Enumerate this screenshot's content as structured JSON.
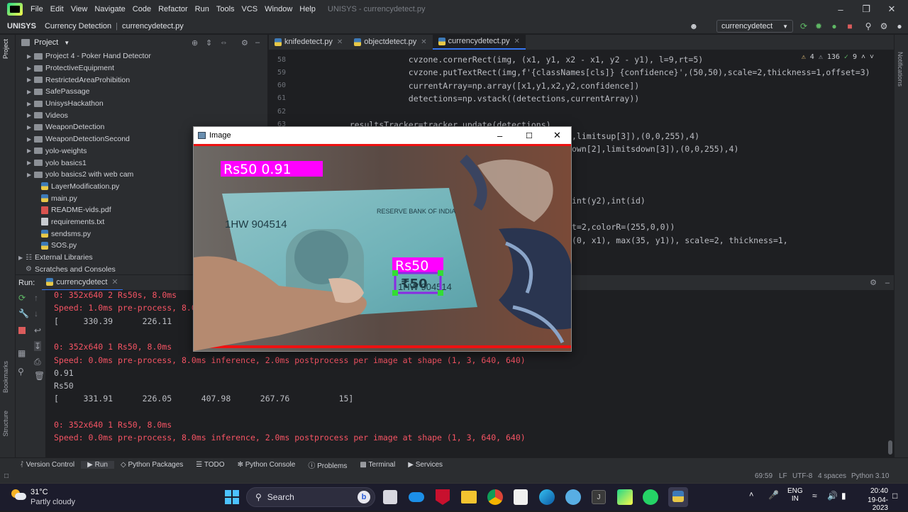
{
  "menubar": {
    "items": [
      "File",
      "Edit",
      "View",
      "Navigate",
      "Code",
      "Refactor",
      "Run",
      "Tools",
      "VCS",
      "Window",
      "Help"
    ],
    "title": "UNISYS - currencydetect.py"
  },
  "navbar": {
    "project": "UNISYS",
    "folder": "Currency Detection",
    "file": "currencydetect.py",
    "run_config": "currencydetect"
  },
  "project_panel": {
    "title": "Project",
    "items": [
      {
        "label": "Project 4 - Poker Hand Detector",
        "type": "folder"
      },
      {
        "label": "ProtectiveEquipment",
        "type": "folder"
      },
      {
        "label": "RestrictedAreaProhibition",
        "type": "folder"
      },
      {
        "label": "SafePassage",
        "type": "folder"
      },
      {
        "label": "UnisysHackathon",
        "type": "folder"
      },
      {
        "label": "Videos",
        "type": "folder"
      },
      {
        "label": "WeaponDetection",
        "type": "folder"
      },
      {
        "label": "WeaponDetectionSecond",
        "type": "folder"
      },
      {
        "label": "yolo-weights",
        "type": "folder"
      },
      {
        "label": "yolo basics1",
        "type": "folder"
      },
      {
        "label": "yolo basics2 with web cam",
        "type": "folder"
      },
      {
        "label": "LayerModification.py",
        "type": "py"
      },
      {
        "label": "main.py",
        "type": "py"
      },
      {
        "label": "README-vids.pdf",
        "type": "pdf"
      },
      {
        "label": "requirements.txt",
        "type": "txt"
      },
      {
        "label": "sendsms.py",
        "type": "py"
      },
      {
        "label": "SOS.py",
        "type": "py"
      },
      {
        "label": "External Libraries",
        "type": "lib"
      },
      {
        "label": "Scratches and Consoles",
        "type": "scratch"
      }
    ]
  },
  "tabs": [
    {
      "label": "knifedetect.py",
      "active": false
    },
    {
      "label": "objectdetect.py",
      "active": false
    },
    {
      "label": "currencydetect.py",
      "active": true
    }
  ],
  "inspection": {
    "warnings": "4",
    "weak": "136",
    "ok": "9"
  },
  "editor_lines": [
    {
      "num": "58",
      "code": "                cvzone.cornerRect(img, (x1, y1, x2 - x1, y2 - y1), l=9,rt=5)"
    },
    {
      "num": "59",
      "code": "                cvzone.putTextRect(img,f'{classNames[cls]} {confidence}',(50,50),scale=2,thickness=1,offset=3)"
    },
    {
      "num": "60",
      "code": "                currentArray=np.array([x1,y1,x2,y2,confidence])"
    },
    {
      "num": "61",
      "code": "                detections=np.vstack((detections,currentArray))"
    },
    {
      "num": "62",
      "code": ""
    },
    {
      "num": "63",
      "code": "    resultsTracker=tracker.update(detections)"
    }
  ],
  "editor_partial_lines": [
    {
      "code": ",limitsup[3]),(0,0,255),4)"
    },
    {
      "code": "own[2],limitsdown[3]),(0,0,255),4)"
    },
    {
      "code": "int(y2),int(id)"
    },
    {
      "code": "t=2,colorR=(255,0,0))"
    },
    {
      "code": "(0, x1), max(35, y1)), scale=2, thickness=1,"
    }
  ],
  "run_panel": {
    "label": "Run:",
    "config": "currencydetect"
  },
  "console_lines": [
    {
      "text": "0: 352x640 2 Rs50s, 8.0ms",
      "color": "#f75464"
    },
    {
      "text": "Speed: 1.0ms pre-process, 8.0",
      "color": "#f75464"
    },
    {
      "text": "[     330.39      226.11",
      "color": "#bcbec4"
    },
    {
      "text": "",
      "color": "#bcbec4"
    },
    {
      "text": "0: 352x640 1 Rs50, 8.0ms",
      "color": "#f75464"
    },
    {
      "text": "Speed: 0.0ms pre-process, 8.0ms inference, 2.0ms postprocess per image at shape (1, 3, 640, 640)",
      "color": "#f75464"
    },
    {
      "text": "0.91",
      "color": "#bcbec4"
    },
    {
      "text": "Rs50",
      "color": "#bcbec4"
    },
    {
      "text": "[     331.91      226.05      407.98      267.76          15]",
      "color": "#bcbec4"
    },
    {
      "text": "",
      "color": "#bcbec4"
    },
    {
      "text": "0: 352x640 1 Rs50, 8.0ms",
      "color": "#f75464"
    },
    {
      "text": "Speed: 0.0ms pre-process, 8.0ms inference, 2.0ms postprocess per image at shape (1, 3, 640, 640)",
      "color": "#f75464"
    }
  ],
  "toolwindows": [
    "Version Control",
    "Run",
    "Python Packages",
    "TODO",
    "Python Console",
    "Problems",
    "Terminal",
    "Services"
  ],
  "statusbar": {
    "position": "69:59",
    "line_sep": "LF",
    "encoding": "UTF-8",
    "indent": "4 spaces",
    "interpreter": "Python 3.10"
  },
  "image_window": {
    "title": "Image",
    "overlay_label": "Rs50 0.91",
    "box_label": "Rs50",
    "note_serial": "1HW 904514",
    "note_bank": "RESERVE BANK OF INDIA",
    "note_value": "₹50"
  },
  "taskbar": {
    "weather_temp": "31°C",
    "weather_desc": "Partly cloudy",
    "search": "Search",
    "lang_top": "ENG",
    "lang_bottom": "IN",
    "time": "20:40",
    "date": "19-04-2023"
  },
  "side_labels": {
    "project": "Project",
    "bookmarks": "Bookmarks",
    "structure": "Structure",
    "notifications": "Notifications"
  },
  "colors": {
    "accent": "#3574f0",
    "error_text": "#f75464",
    "green": "#5fb865",
    "magenta": "#ff00ff"
  }
}
